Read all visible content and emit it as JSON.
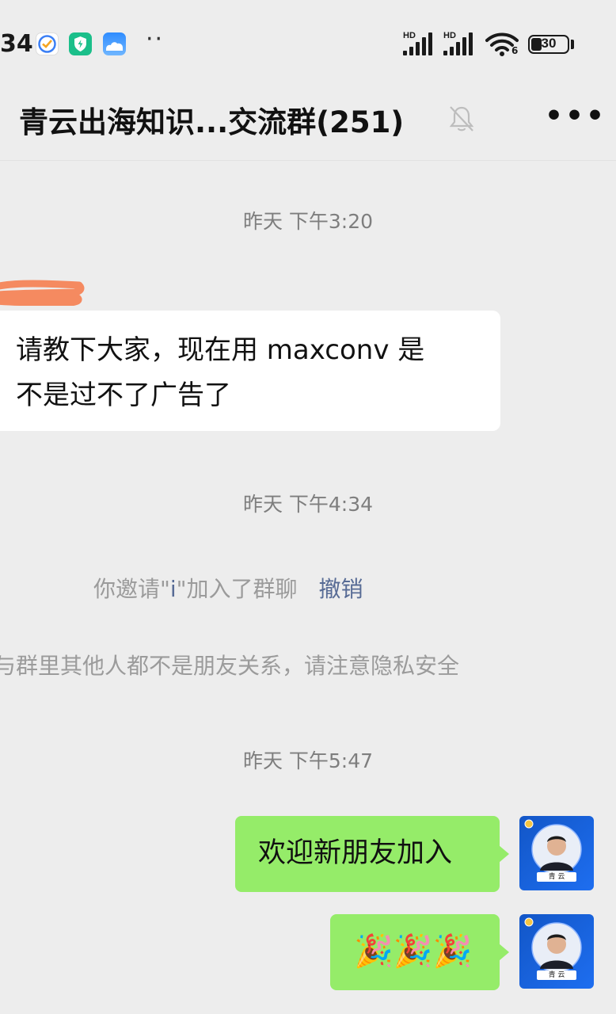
{
  "status_bar": {
    "time": "34",
    "dots": "··",
    "hd1": "HD",
    "hd2": "HD",
    "wifi_sub": "6",
    "battery": "30"
  },
  "header": {
    "title": "青云出海知识...交流群(251)"
  },
  "messages": [
    {
      "type": "timestamp",
      "text": "昨天  下午3:20"
    },
    {
      "type": "incoming",
      "text_line1": "请教下大家，现在用 maxconv 是",
      "text_line2": "不是过不了广告了"
    },
    {
      "type": "timestamp",
      "text": "昨天  下午4:34"
    },
    {
      "type": "system",
      "prefix": "你邀请\"",
      "name": "i",
      "suffix": "\"加入了群聊",
      "action": "撤销"
    },
    {
      "type": "system",
      "text": "与群里其他人都不是朋友关系，请注意隐私安全"
    },
    {
      "type": "timestamp",
      "text": "昨天  下午5:47"
    },
    {
      "type": "outgoing",
      "text": "欢迎新朋友加入"
    },
    {
      "type": "outgoing",
      "text": "🎉🎉🎉"
    }
  ],
  "avatar": {
    "caption": "青 云"
  },
  "colors": {
    "bg": "#ededed",
    "bubble_out": "#95ec69",
    "link": "#576b95"
  },
  "icons": [
    "checkmark-app-icon",
    "shield-app-icon",
    "cloud-app-icon",
    "signal-icon",
    "wifi-icon",
    "battery-icon",
    "mute-bell-icon",
    "more-icon"
  ]
}
